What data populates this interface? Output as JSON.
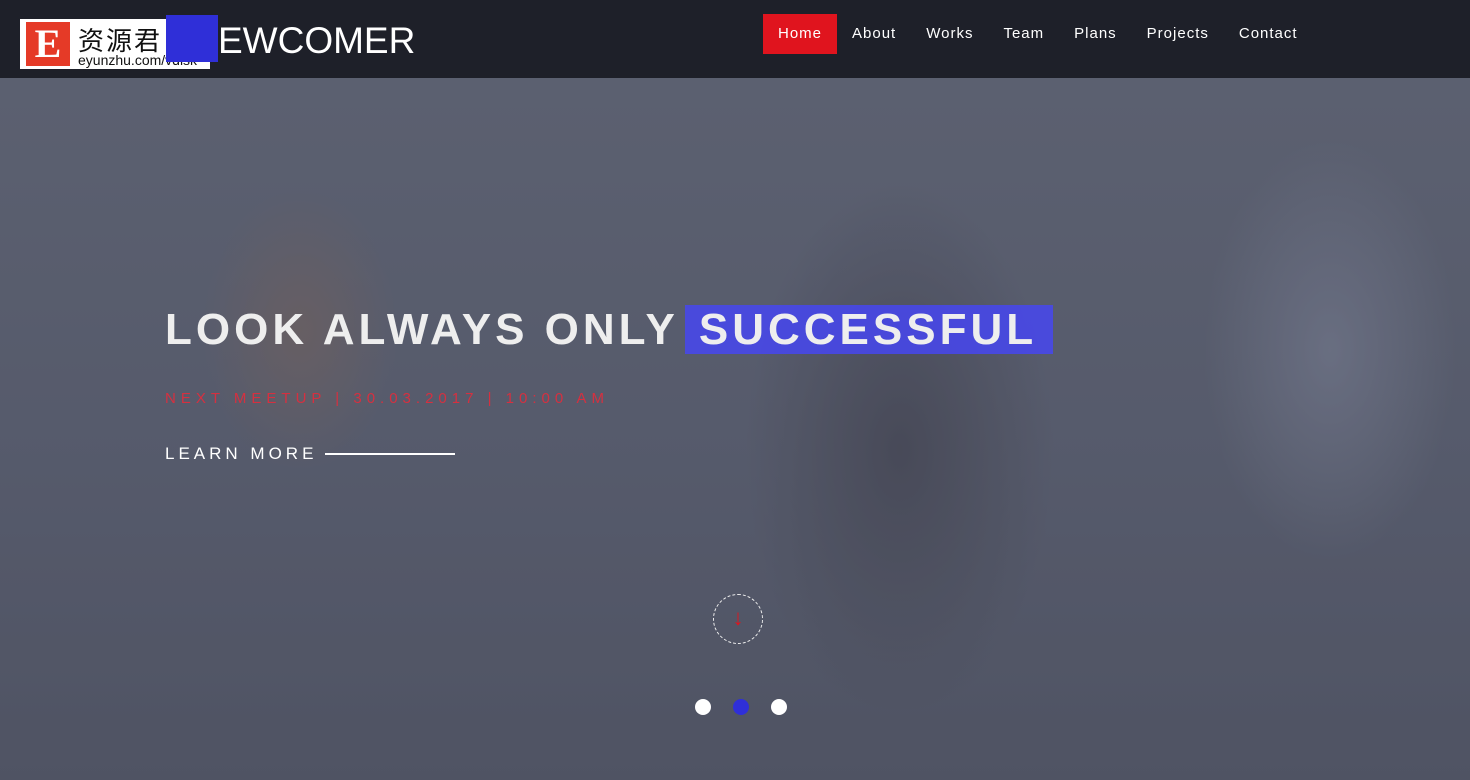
{
  "logo": {
    "cn": "资源君",
    "url": "eyunzhu.com/vdisk",
    "letter": "E"
  },
  "brand": "EWCOMER",
  "nav": [
    {
      "label": "Home",
      "active": true
    },
    {
      "label": "About"
    },
    {
      "label": "Works"
    },
    {
      "label": "Team"
    },
    {
      "label": "Plans"
    },
    {
      "label": "Projects"
    },
    {
      "label": "Contact"
    }
  ],
  "hero": {
    "headline": "LOOK ALWAYS ONLY",
    "highlight": "SUCCESSFUL",
    "meetup": "NEXT MEETUP | 30.03.2017 | 10:00 AM",
    "learn_more": "LEARN MORE",
    "scroll_icon": "↓"
  },
  "slider": {
    "count": 3,
    "active_index": 1
  },
  "colors": {
    "accent": "#2f2fd8",
    "red": "#e0141e"
  }
}
